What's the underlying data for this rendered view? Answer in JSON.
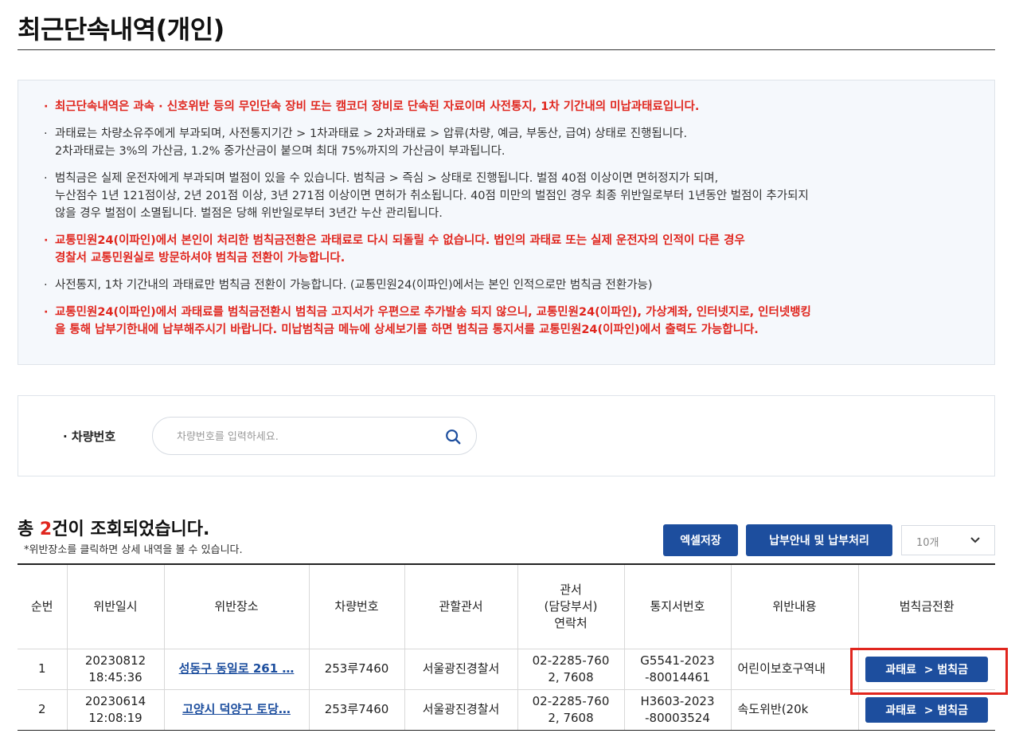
{
  "page": {
    "title": "최근단속내역(개인)"
  },
  "notice": {
    "bullet": "·",
    "items": [
      {
        "red": true,
        "lines": [
          "최근단속내역은 과속 · 신호위반 등의 무인단속 장비 또는 캠코더 장비로 단속된 자료이며 사전통지, 1차 기간내의 미납과태료입니다."
        ]
      },
      {
        "red": false,
        "lines": [
          "과태료는 차량소유주에게 부과되며, 사전통지기간 > 1차과태료 > 2차과태료 > 압류(차량, 예금, 부동산, 급여) 상태로 진행됩니다.",
          "2차과태료는 3%의 가산금, 1.2% 중가산금이 붙으며 최대 75%까지의 가산금이 부과됩니다."
        ]
      },
      {
        "red": false,
        "lines": [
          "범칙금은 실제 운전자에게 부과되며 벌점이 있을 수 있습니다. 범칙금 > 즉심 > 상태로 진행됩니다. 벌점 40점 이상이면 면허정지가 되며,",
          "누산점수 1년 121점이상, 2년 201점 이상, 3년 271점 이상이면 면허가 취소됩니다. 40점 미만의 벌점인 경우 최종 위반일로부터 1년동안 벌점이 추가되지",
          "않을 경우 벌점이 소멸됩니다. 벌점은 당해 위반일로부터 3년간 누산 관리됩니다."
        ]
      },
      {
        "red": true,
        "lines": [
          "교통민원24(이파인)에서 본인이 처리한 범칙금전환은 과태료로 다시 되돌릴 수 없습니다. 법인의 과태료 또는 실제 운전자의 인적이 다른 경우",
          "경찰서 교통민원실로 방문하셔야 범칙금 전환이 가능합니다."
        ]
      },
      {
        "red": false,
        "lines": [
          "사전통지, 1차 기간내의 과태료만 범칙금 전환이 가능합니다. (교통민원24(이파인)에서는 본인 인적으로만 범칙금 전환가능)"
        ]
      },
      {
        "red": true,
        "lines": [
          "교통민원24(이파인)에서 과태료를 범칙금전환시 범칙금 고지서가 우편으로 추가발송 되지 않으니, 교통민원24(이파인), 가상계좌, 인터넷지로, 인터넷뱅킹",
          "을 통해 납부기한내에 납부해주시기 바랍니다. 미납범칙금 메뉴에 상세보기를 하면 범칙금 통지서를 교통민원24(이파인)에서 출력도 가능합니다."
        ]
      }
    ]
  },
  "search": {
    "label": "· 차량번호",
    "placeholder": "차량번호를 입력하세요.",
    "value": ""
  },
  "results": {
    "prefix": "총 ",
    "count": "2",
    "suffix": "건이 조회되었습니다.",
    "hint": "*위반장소를 클릭하면 상세 내역을 볼 수 있습니다.",
    "excel_label": "엑셀저장",
    "pay_label": "납부안내 및 납부처리",
    "page_size": "10개"
  },
  "table": {
    "headers": [
      "순번",
      "위반일시",
      "위반장소",
      "차량번호",
      "관할관서",
      "관서\n(담당부서)\n연락처",
      "통지서번호",
      "위반내용",
      "범칙금전환"
    ],
    "rows": [
      {
        "no": "1",
        "date": "20230812",
        "time": "18:45:36",
        "location": "성동구 동일로 261 …",
        "car": "253루7460",
        "office": "서울광진경찰서",
        "phone1": "02-2285-760",
        "phone2": "2, 7608",
        "notice1": "G5541-2023",
        "notice2": "-80014461",
        "violation": "어린이보호구역내",
        "convert": "과태료  > 범칙금"
      },
      {
        "no": "2",
        "date": "20230614",
        "time": "12:08:19",
        "location": "고양시 덕양구 토당…",
        "car": "253루7460",
        "office": "서울광진경찰서",
        "phone1": "02-2285-760",
        "phone2": "2, 7608",
        "notice1": "H3603-2023",
        "notice2": "-80003524",
        "violation": "속도위반(20k",
        "convert": "과태료  > 범칙금"
      }
    ]
  },
  "colors": {
    "accent": "#1d4e9e",
    "alert": "#e0261e",
    "notice_bg": "#f5f8fc"
  },
  "icons": {
    "search": "search-icon",
    "dropdown": "chevron-down-icon"
  }
}
